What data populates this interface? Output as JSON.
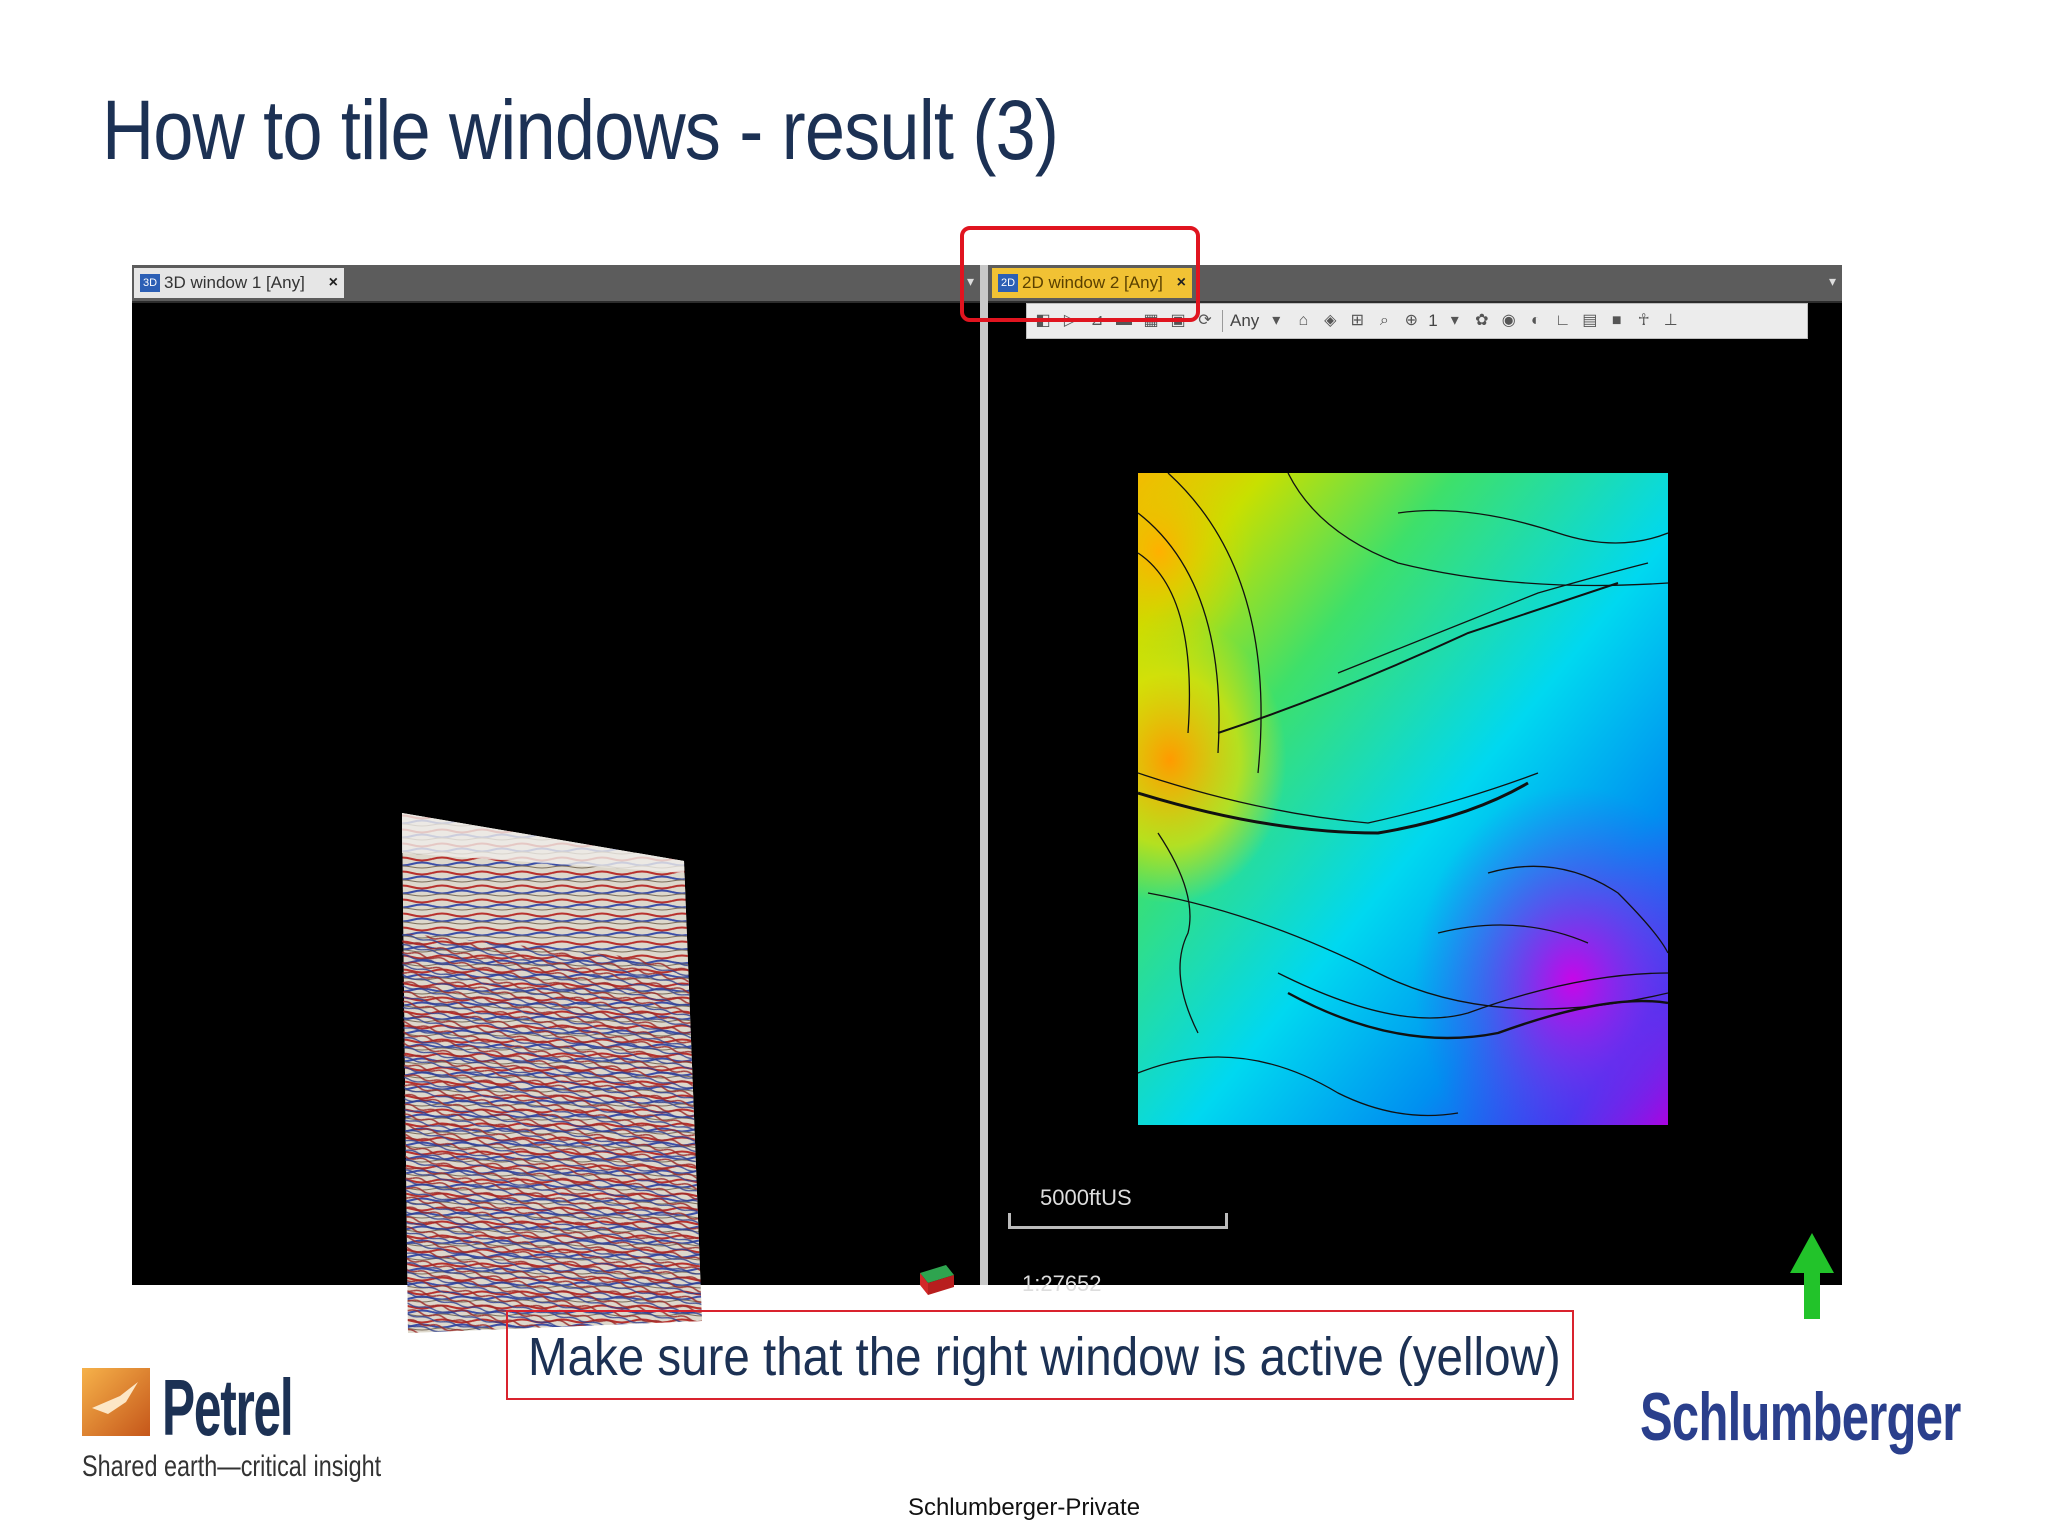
{
  "slide": {
    "title": "How to tile windows - result (3)"
  },
  "left_window": {
    "badge": "3D",
    "tab_label": "3D window 1 [Any]",
    "close_glyph": "×"
  },
  "right_window": {
    "badge": "2D",
    "tab_label": "2D window 2 [Any]",
    "close_glyph": "×",
    "tab_state_color": "#f1c234",
    "toolbar": {
      "selector_value": "Any",
      "number_value": "1"
    },
    "scale_bar_label": "5000ftUS",
    "scale_ratio": "1:27652"
  },
  "caption": "Make sure that the right window is active (yellow)",
  "branding": {
    "petrel_name": "Petrel",
    "petrel_tagline": "Shared earth—critical insight",
    "company": "Schlumberger"
  },
  "footer": "Schlumberger-Private",
  "colors": {
    "title": "#1c3154",
    "highlight": "#e0141f",
    "accent_blue": "#2a3f8c"
  }
}
